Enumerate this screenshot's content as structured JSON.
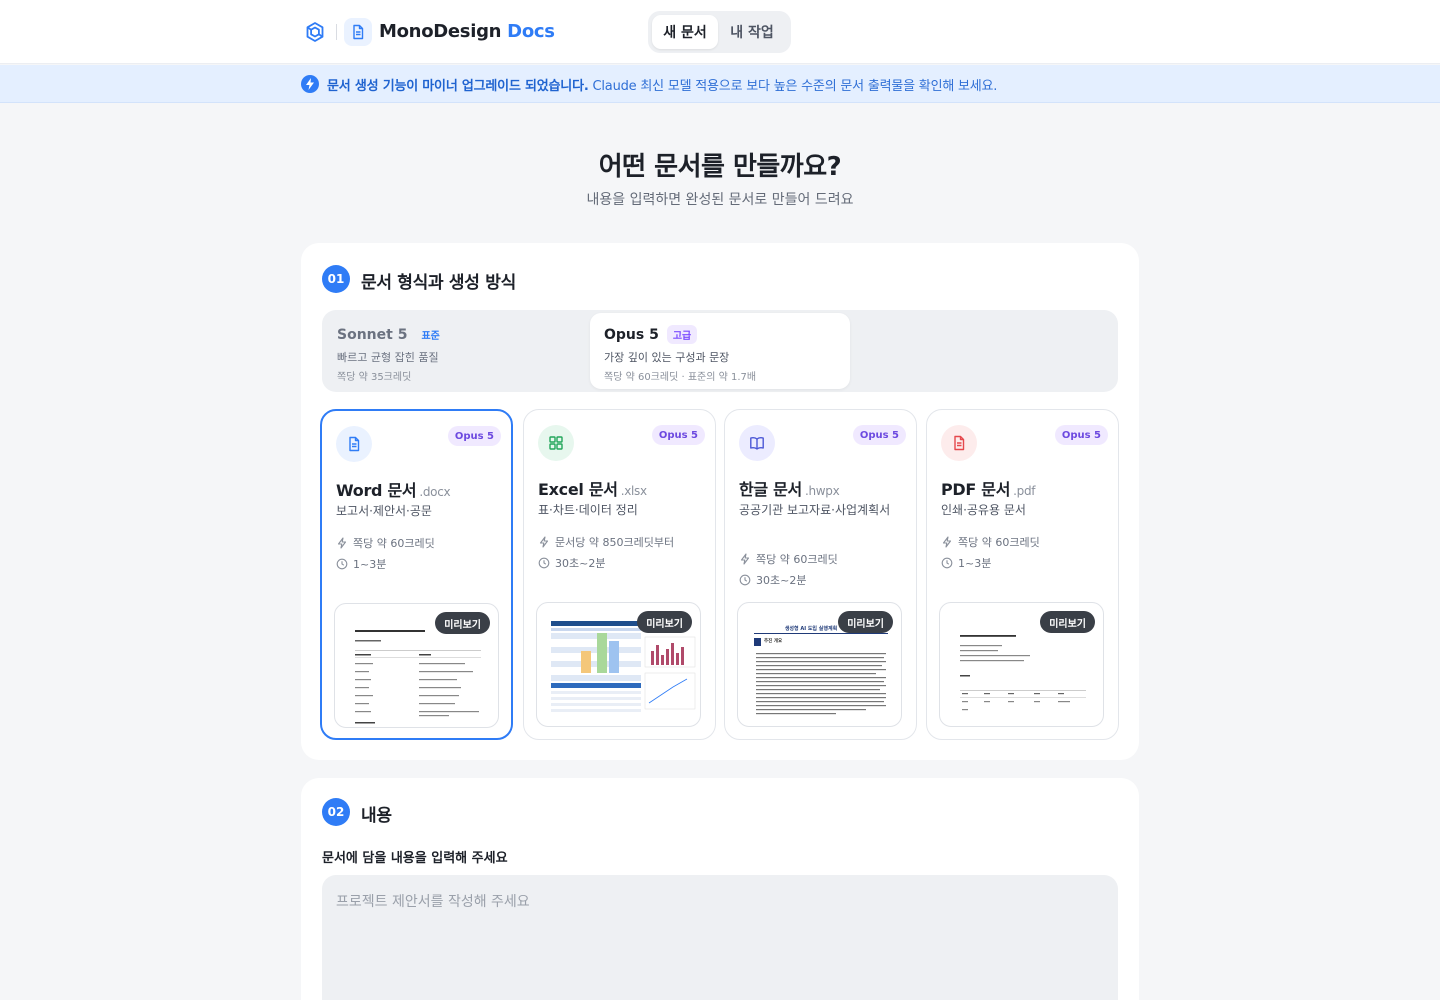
{
  "header": {
    "brand_main": "MonoDesign",
    "brand_accent": "Docs",
    "nav": [
      {
        "label": "새 문서",
        "active": true
      },
      {
        "label": "내 작업",
        "active": false
      }
    ],
    "logo_icon": "hex-logo-icon",
    "doc_icon": "document-icon"
  },
  "banner": {
    "bold": "문서 생성 기능이 마이너 업그레이드 되었습니다.",
    "text": " Claude 최신 모델 적용으로 보다 높은 수준의 문서 출력물을 확인해 보세요.",
    "icon": "bolt-icon"
  },
  "hero": {
    "title": "어떤 문서를 만들까요?",
    "subtitle": "내용을 입력하면 완성된 문서로 만들어 드려요"
  },
  "step1": {
    "badge": "01",
    "title": "문서 형식과 생성 방식",
    "models": [
      {
        "name": "Sonnet 5",
        "tag": "표준",
        "desc": "빠르고 균형 잡힌 품질",
        "cost": "쪽당 약 35크레딧",
        "selected": false
      },
      {
        "name": "Opus 5",
        "tag": "고급",
        "desc": "가장 깊이 있는 구성과 문장",
        "cost": "쪽당 약 60크레딧 · 표준의 약 1.7배",
        "selected": true
      }
    ],
    "formats": [
      {
        "badge": "Opus 5",
        "title": "Word 문서",
        "ext": ".docx",
        "desc": "보고서·제안서·공문",
        "credit": "쪽당 약 60크레딧",
        "time": "1~3분",
        "preview": "미리보기",
        "icon": "document-icon",
        "selected": true
      },
      {
        "badge": "Opus 5",
        "title": "Excel 문서",
        "ext": ".xlsx",
        "desc": "표·차트·데이터 정리",
        "credit": "문서당 약 850크레딧부터",
        "time": "30초~2분",
        "preview": "미리보기",
        "icon": "grid-icon",
        "selected": false
      },
      {
        "badge": "Opus 5",
        "title": "한글 문서",
        "ext": ".hwpx",
        "desc": "공공기관 보고자료·사업계획서",
        "credit": "쪽당 약 60크레딧",
        "time": "30초~2분",
        "preview": "미리보기",
        "icon": "book-icon",
        "selected": false
      },
      {
        "badge": "Opus 5",
        "title": "PDF 문서",
        "ext": ".pdf",
        "desc": "인쇄·공유용 문서",
        "credit": "쪽당 약 60크레딧",
        "time": "1~3분",
        "preview": "미리보기",
        "icon": "pdf-icon",
        "selected": false
      }
    ],
    "hwp_preview_title": "생성형 AI 도입 실행계획",
    "hwp_preview_section": "추진 개요"
  },
  "step2": {
    "badge": "02",
    "title": "내용",
    "label": "문서에 담을 내용을 입력해 주세요",
    "placeholder": "프로젝트 제안서를 작성해 주세요",
    "value": ""
  },
  "colors": {
    "accent": "#2f7cf6",
    "badge_purple": "#6d4ae0",
    "excel_green": "#22a55a",
    "pdf_red": "#e5484d"
  }
}
